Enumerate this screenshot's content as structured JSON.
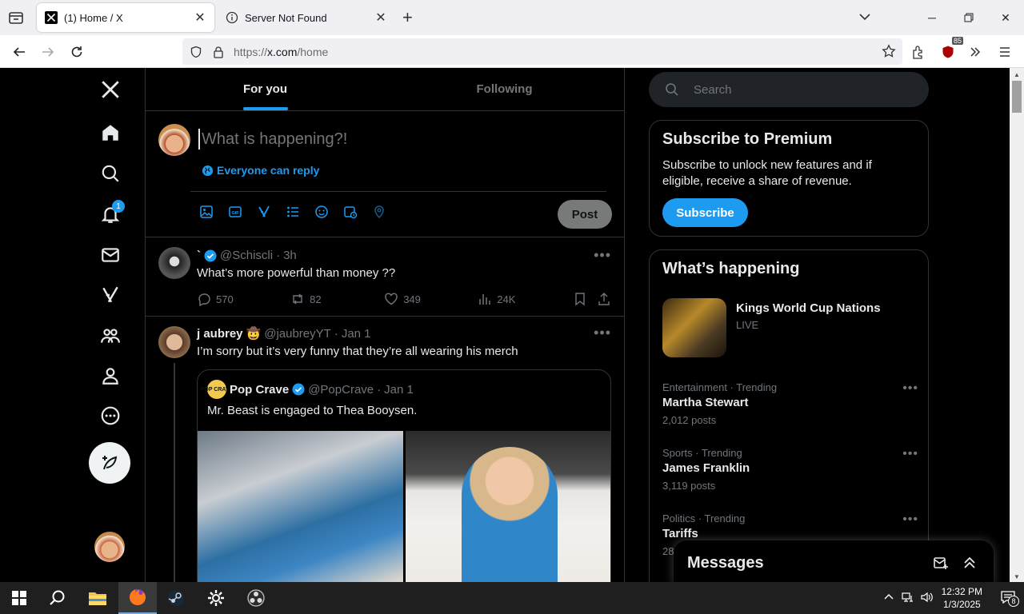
{
  "browser": {
    "tabs": [
      {
        "title": "(1) Home / X",
        "active": true
      },
      {
        "title": "Server Not Found",
        "active": false
      }
    ],
    "url": {
      "protocol": "https://",
      "host": "x.com",
      "path": "/home"
    },
    "extension_badge": "85"
  },
  "x": {
    "timeline_tabs": [
      "For you",
      "Following"
    ],
    "composer": {
      "placeholder": "What is happening?!",
      "reply_setting": "Everyone can reply",
      "post_label": "Post"
    },
    "notifications_count": "1",
    "tweets": [
      {
        "name": "`",
        "handle": "@Schiscli",
        "time": "3h",
        "text": "What’s more powerful than money ??",
        "replies": "570",
        "reposts": "82",
        "likes": "349",
        "views": "24K"
      },
      {
        "name": "j aubrey",
        "emoji": "🤠",
        "handle": "@jaubreyYT",
        "time": "Jan 1",
        "text": "I’m sorry but it’s very funny that they’re all wearing his merch",
        "quote": {
          "avatar_text": "POP CRAVE",
          "name": "Pop Crave",
          "handle": "@PopCrave",
          "time": "Jan 1",
          "text": "Mr. Beast is engaged to Thea Booysen."
        }
      }
    ],
    "search_placeholder": "Search",
    "premium": {
      "title": "Subscribe to Premium",
      "text": "Subscribe to unlock new features and if eligible, receive a share of revenue.",
      "button": "Subscribe"
    },
    "happening": {
      "title": "What’s happening",
      "event": {
        "title": "Kings World Cup Nations",
        "status": "LIVE"
      },
      "trends": [
        {
          "category": "Entertainment · Trending",
          "name": "Martha Stewart",
          "posts": "2,012 posts"
        },
        {
          "category": "Sports · Trending",
          "name": "James Franklin",
          "posts": "3,119 posts"
        },
        {
          "category": "Politics · Trending",
          "name": "Tariffs",
          "posts": "28"
        }
      ]
    },
    "messages_title": "Messages"
  },
  "taskbar": {
    "time": "12:32 PM",
    "date": "1/3/2025",
    "notification_count": "8"
  }
}
